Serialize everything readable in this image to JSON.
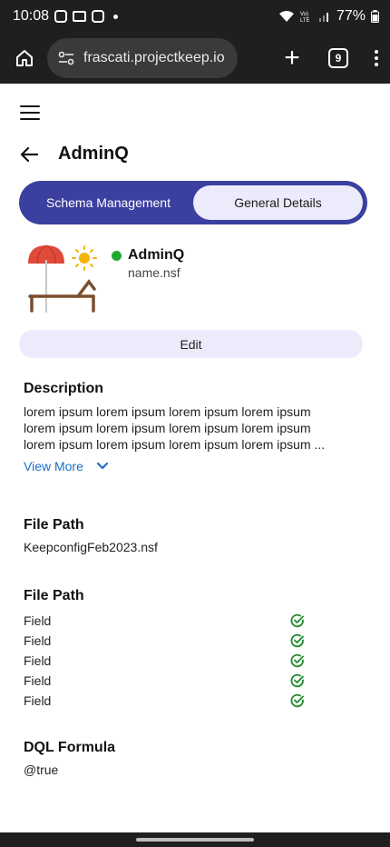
{
  "status_bar": {
    "time": "10:08",
    "battery": "77%"
  },
  "browser": {
    "url": "frascati.projectkeep.io",
    "tab_count": "9"
  },
  "header": {
    "title": "AdminQ"
  },
  "tabs": [
    {
      "label": "Schema Management",
      "active": false
    },
    {
      "label": "General Details",
      "active": true
    }
  ],
  "app": {
    "name": "AdminQ",
    "file": "name.nsf",
    "status_color": "#1faa2f"
  },
  "edit_label": "Edit",
  "description": {
    "title": "Description",
    "lines": [
      "lorem ipsum lorem ipsum lorem ipsum lorem ipsum",
      "lorem ipsum lorem ipsum lorem ipsum lorem ipsum",
      "lorem ipsum lorem ipsum lorem ipsum lorem ipsum ..."
    ],
    "view_more": "View More"
  },
  "file_path": {
    "title": "File Path",
    "value": "KeepconfigFeb2023.nsf"
  },
  "fields_section": {
    "title": "File Path",
    "fields": [
      "Field",
      "Field",
      "Field",
      "Field",
      "Field"
    ]
  },
  "dql": {
    "title": "DQL Formula",
    "value": "@true"
  },
  "colors": {
    "accent": "#3b40a0",
    "tab_active_bg": "#ecebfb",
    "link": "#1a6fc9",
    "check": "#1a8a2a"
  }
}
